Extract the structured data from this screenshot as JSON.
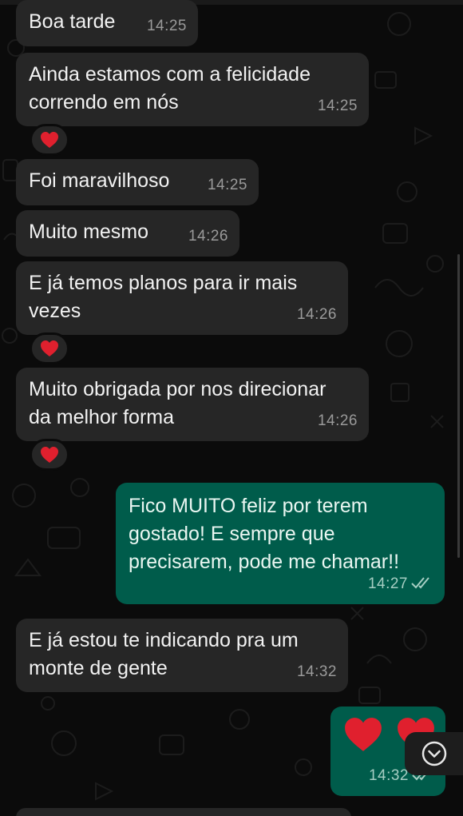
{
  "chat": {
    "messages": [
      {
        "id": "m1",
        "direction": "incoming",
        "text": "Boa tarde",
        "time": "14:25",
        "reaction": null
      },
      {
        "id": "m2",
        "direction": "incoming",
        "text": "Ainda estamos com a felicidade\ncorrendo em nós",
        "time": "14:25",
        "reaction": "red-heart"
      },
      {
        "id": "m3",
        "direction": "incoming",
        "text": "Foi maravilhoso",
        "time": "14:25",
        "reaction": null
      },
      {
        "id": "m4",
        "direction": "incoming",
        "text": "Muito mesmo",
        "time": "14:26",
        "reaction": null
      },
      {
        "id": "m5",
        "direction": "incoming",
        "text": "E já temos planos para ir mais\nvezes",
        "time": "14:26",
        "reaction": "red-heart"
      },
      {
        "id": "m6",
        "direction": "incoming",
        "text": "Muito obrigada por nos direcionar\nda melhor forma",
        "time": "14:26",
        "reaction": "red-heart"
      },
      {
        "id": "m7",
        "direction": "outgoing",
        "text": "Fico MUITO feliz por terem\ngostado! E sempre que\nprecisarem, pode me chamar!!",
        "time": "14:27",
        "status": "read-double-check"
      },
      {
        "id": "m8",
        "direction": "incoming",
        "text": "E já estou te indicando pra um\nmonte de gente",
        "time": "14:32",
        "reaction": null
      },
      {
        "id": "m9",
        "direction": "outgoing",
        "emoji": [
          "red-heart",
          "red-heart"
        ],
        "time": "14:32",
        "status": "read-double-check"
      }
    ]
  },
  "controls": {
    "scroll_down_icon": "chevron-down-circle-icon"
  },
  "colors": {
    "background": "#0b0b0b",
    "incoming_bubble": "#262626",
    "outgoing_bubble": "#005c4b",
    "heart": "#e0202e"
  }
}
